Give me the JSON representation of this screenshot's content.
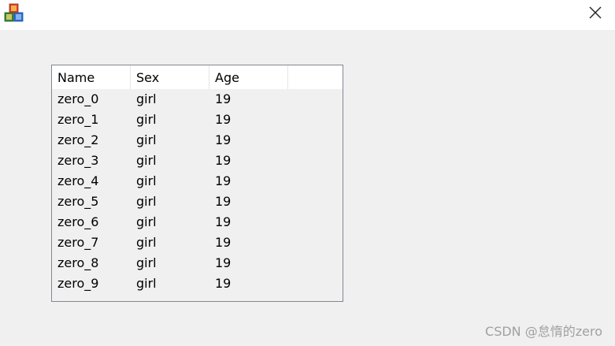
{
  "titlebar": {
    "app_icon": "toy-blocks-icon",
    "close_icon": "close-icon"
  },
  "listview": {
    "columns": [
      "Name",
      "Sex",
      "Age"
    ],
    "rows": [
      [
        "zero_0",
        "girl",
        "19"
      ],
      [
        "zero_1",
        "girl",
        "19"
      ],
      [
        "zero_2",
        "girl",
        "19"
      ],
      [
        "zero_3",
        "girl",
        "19"
      ],
      [
        "zero_4",
        "girl",
        "19"
      ],
      [
        "zero_5",
        "girl",
        "19"
      ],
      [
        "zero_6",
        "girl",
        "19"
      ],
      [
        "zero_7",
        "girl",
        "19"
      ],
      [
        "zero_8",
        "girl",
        "19"
      ],
      [
        "zero_9",
        "girl",
        "19"
      ]
    ]
  },
  "watermark": "CSDN @怠惰的zero",
  "colors": {
    "titlebar_bg": "#ffffff",
    "window_bg": "#f0f0f0",
    "list_border": "#828790"
  }
}
